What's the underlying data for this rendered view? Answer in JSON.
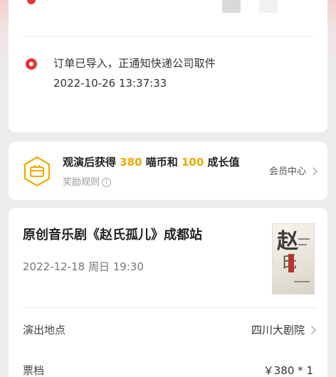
{
  "order_status": {
    "message": "订单已导入，正通知快递公司取件",
    "time": "2022-10-26 13:37:33"
  },
  "reward": {
    "text_prefix": "观演后获得 ",
    "coins": "380",
    "text_mid": " 喵币和 ",
    "growth": "100",
    "text_suffix": " 成长值",
    "rule_label": "奖励规则",
    "info_glyph": "i",
    "member_center": "会员中心",
    "accent_color": "#f0a900"
  },
  "show": {
    "title": "原创音乐剧《赵氏孤儿》成都站",
    "datetime": "2022-12-18 周日 19:30",
    "poster_text_1": "赵",
    "poster_text_2": "氏",
    "venue_label": "演出地点",
    "venue_value": "四川大剧院",
    "ticket_label": "票档",
    "ticket_value": "￥380 * 1"
  },
  "colors": {
    "status_red": "#e8333c",
    "reward_icon": "#f0a900"
  }
}
